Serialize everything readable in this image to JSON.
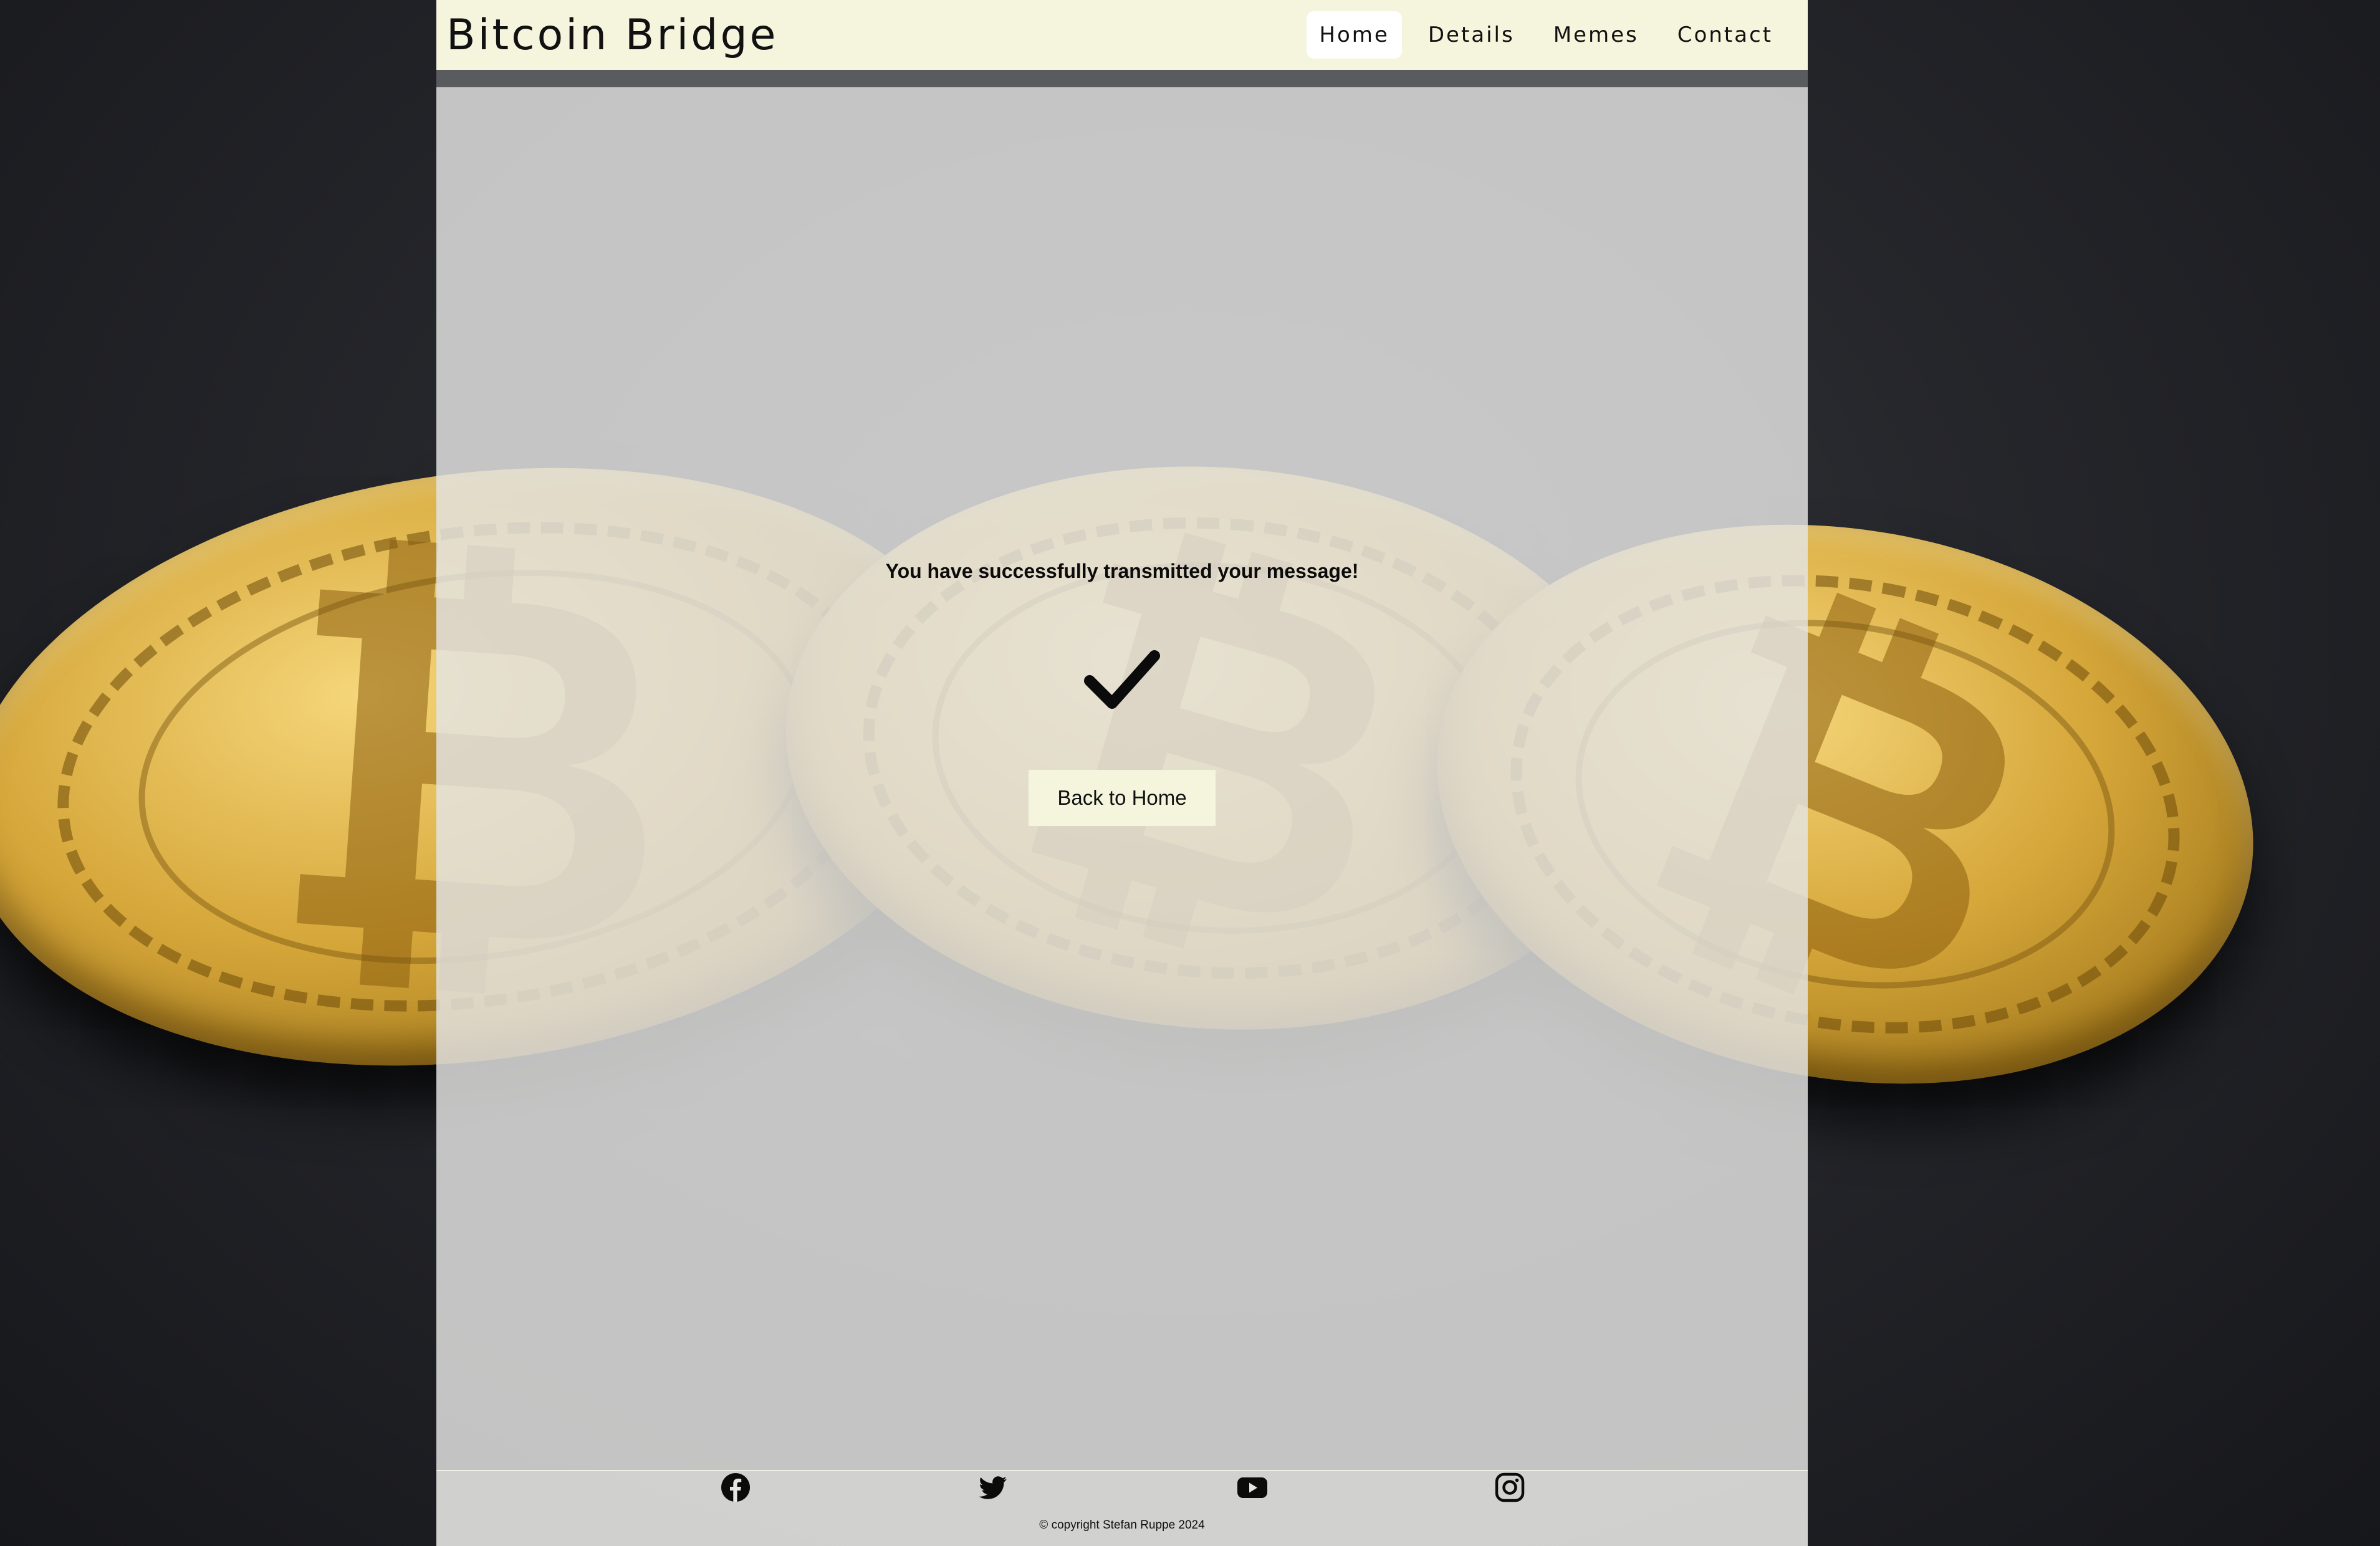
{
  "header": {
    "brand": "Bitcoin Bridge",
    "nav": [
      {
        "label": "Home",
        "active": true
      },
      {
        "label": "Details",
        "active": false
      },
      {
        "label": "Memes",
        "active": false
      },
      {
        "label": "Contact",
        "active": false
      }
    ]
  },
  "main": {
    "message": "You have successfully transmitted your message!",
    "icon": "checkmark-icon",
    "back_button": "Back to Home"
  },
  "footer": {
    "social": [
      "facebook-icon",
      "twitter-icon",
      "youtube-icon",
      "instagram-icon"
    ],
    "copyright": "© copyright Stefan Ruppe 2024"
  },
  "colors": {
    "header_bg": "#f4f5dc",
    "header_bar": "#5a5b5e",
    "button_bg": "#f4f5dc",
    "overlay": "#e4e4e2",
    "text": "#111111"
  }
}
